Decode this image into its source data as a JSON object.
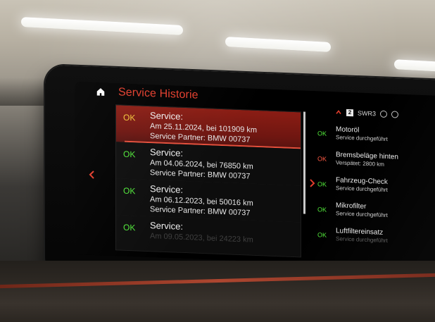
{
  "app": {
    "title": "Service Historie",
    "colors": {
      "title_red": "#e23d2c",
      "ok_green": "#51e53a",
      "ok_yellow_selected": "#f2c43a",
      "overdue_orange": "#ff5a44",
      "selected_row_red": "#8b1d14"
    },
    "icons": {
      "home": "home-icon",
      "left_nav": "chevron-left-icon",
      "right_nav": "chevron-right-icon",
      "status_up": "chevron-up-icon",
      "radio_badge": "radio-icon"
    }
  },
  "status_bar": {
    "preset": "2",
    "station": "SWR3"
  },
  "service_history": {
    "entries": [
      {
        "status": "OK",
        "title": "Service:",
        "date_line": "Am 25.11.2024, bei 101909 km",
        "partner_line": "Service Partner: BMW 00737"
      },
      {
        "status": "OK",
        "title": "Service:",
        "date_line": "Am 04.06.2024, bei 76850 km",
        "partner_line": "Service Partner: BMW 00737"
      },
      {
        "status": "OK",
        "title": "Service:",
        "date_line": "Am 06.12.2023, bei 50016 km",
        "partner_line": "Service Partner: BMW 00737"
      },
      {
        "status": "OK",
        "title": "Service:",
        "date_line": "Am 09.05.2023, bei 24223 km",
        "partner_line": ""
      }
    ]
  },
  "maintenance_status": {
    "items": [
      {
        "code": "OK",
        "name": "Motoröl",
        "detail": "Service durchgeführt"
      },
      {
        "code": "OK",
        "name": "Bremsbeläge hinten",
        "detail": "Verspätet: 2800 km"
      },
      {
        "code": "OK",
        "name": "Fahrzeug-Check",
        "detail": "Service durchgeführt"
      },
      {
        "code": "OK",
        "name": "Mikrofilter",
        "detail": "Service durchgeführt"
      },
      {
        "code": "OK",
        "name": "Luftfiltereinsatz",
        "detail": "Service durchgeführt"
      }
    ]
  }
}
